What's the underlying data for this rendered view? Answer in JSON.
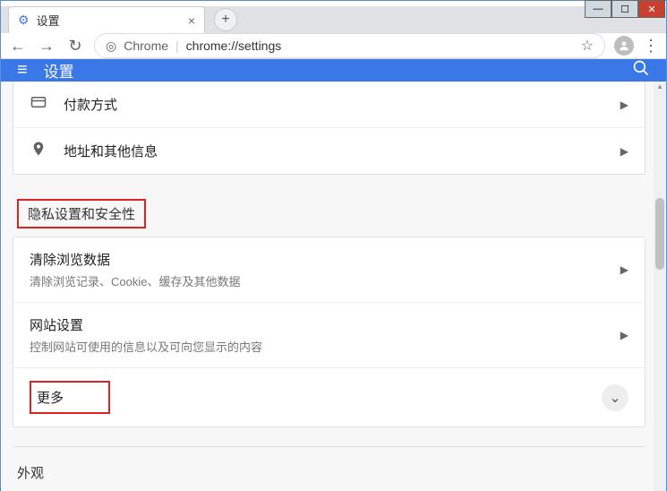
{
  "window": {
    "tab_title": "设置",
    "tab_close": "×",
    "new_tab": "+"
  },
  "toolbar": {
    "back": "←",
    "forward": "→",
    "reload": "↻",
    "omnibox_prefix": "Chrome",
    "omnibox_url": "chrome://settings",
    "star": "☆",
    "menu": "⋮"
  },
  "appbar": {
    "menu": "≡",
    "title": "设置"
  },
  "autofill_section": {
    "rows": [
      {
        "icon": "credit-card",
        "title": "付款方式"
      },
      {
        "icon": "location",
        "title": "地址和其他信息"
      }
    ]
  },
  "privacy_section": {
    "heading": "隐私设置和安全性",
    "rows": [
      {
        "title": "清除浏览数据",
        "sub": "清除浏览记录、Cookie、缓存及其他数据"
      },
      {
        "title": "网站设置",
        "sub": "控制网站可使用的信息以及可向您显示的内容"
      }
    ],
    "more_label": "更多"
  },
  "appearance_section": {
    "heading": "外观"
  }
}
